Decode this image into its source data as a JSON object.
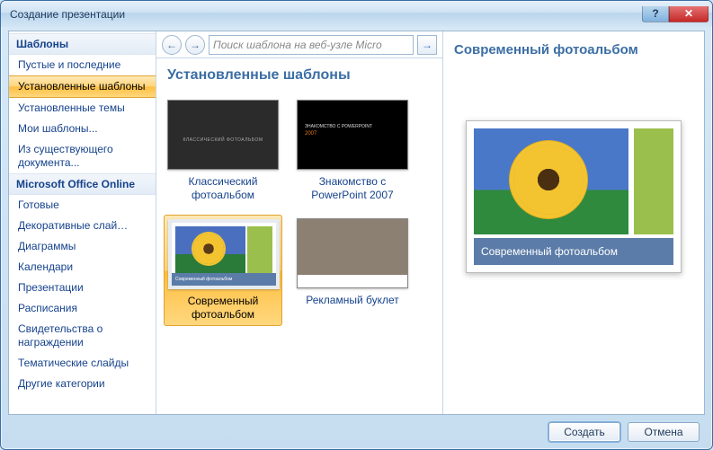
{
  "window": {
    "title": "Создание презентации"
  },
  "sidebar": {
    "heading1": "Шаблоны",
    "items1": [
      "Пустые и последние",
      "Установленные шаблоны",
      "Установленные темы",
      "Мои шаблоны...",
      "Из существующего документа..."
    ],
    "selected1": 1,
    "heading2": "Microsoft Office Online",
    "items2": [
      "Готовые",
      "Декоративные слай…",
      "Диаграммы",
      "Календари",
      "Презентации",
      "Расписания",
      "Свидетельства о награждении",
      "Тематические слайды",
      "Другие категории"
    ]
  },
  "gallery": {
    "search_placeholder": "Поиск шаблона на веб-узле Micro",
    "heading": "Установленные шаблоны",
    "templates": [
      {
        "label": "Классический фотоальбом",
        "thumb": "classic"
      },
      {
        "label": "Знакомство с PowerPoint 2007",
        "thumb": "intro"
      },
      {
        "label": "Современный фотоальбом",
        "thumb": "modern"
      },
      {
        "label": "Рекламный буклет",
        "thumb": "booklet"
      }
    ],
    "selected": 2
  },
  "preview": {
    "title": "Современный фотоальбом",
    "caption": "Современный фотоальбом"
  },
  "footer": {
    "create": "Создать",
    "cancel": "Отмена"
  }
}
